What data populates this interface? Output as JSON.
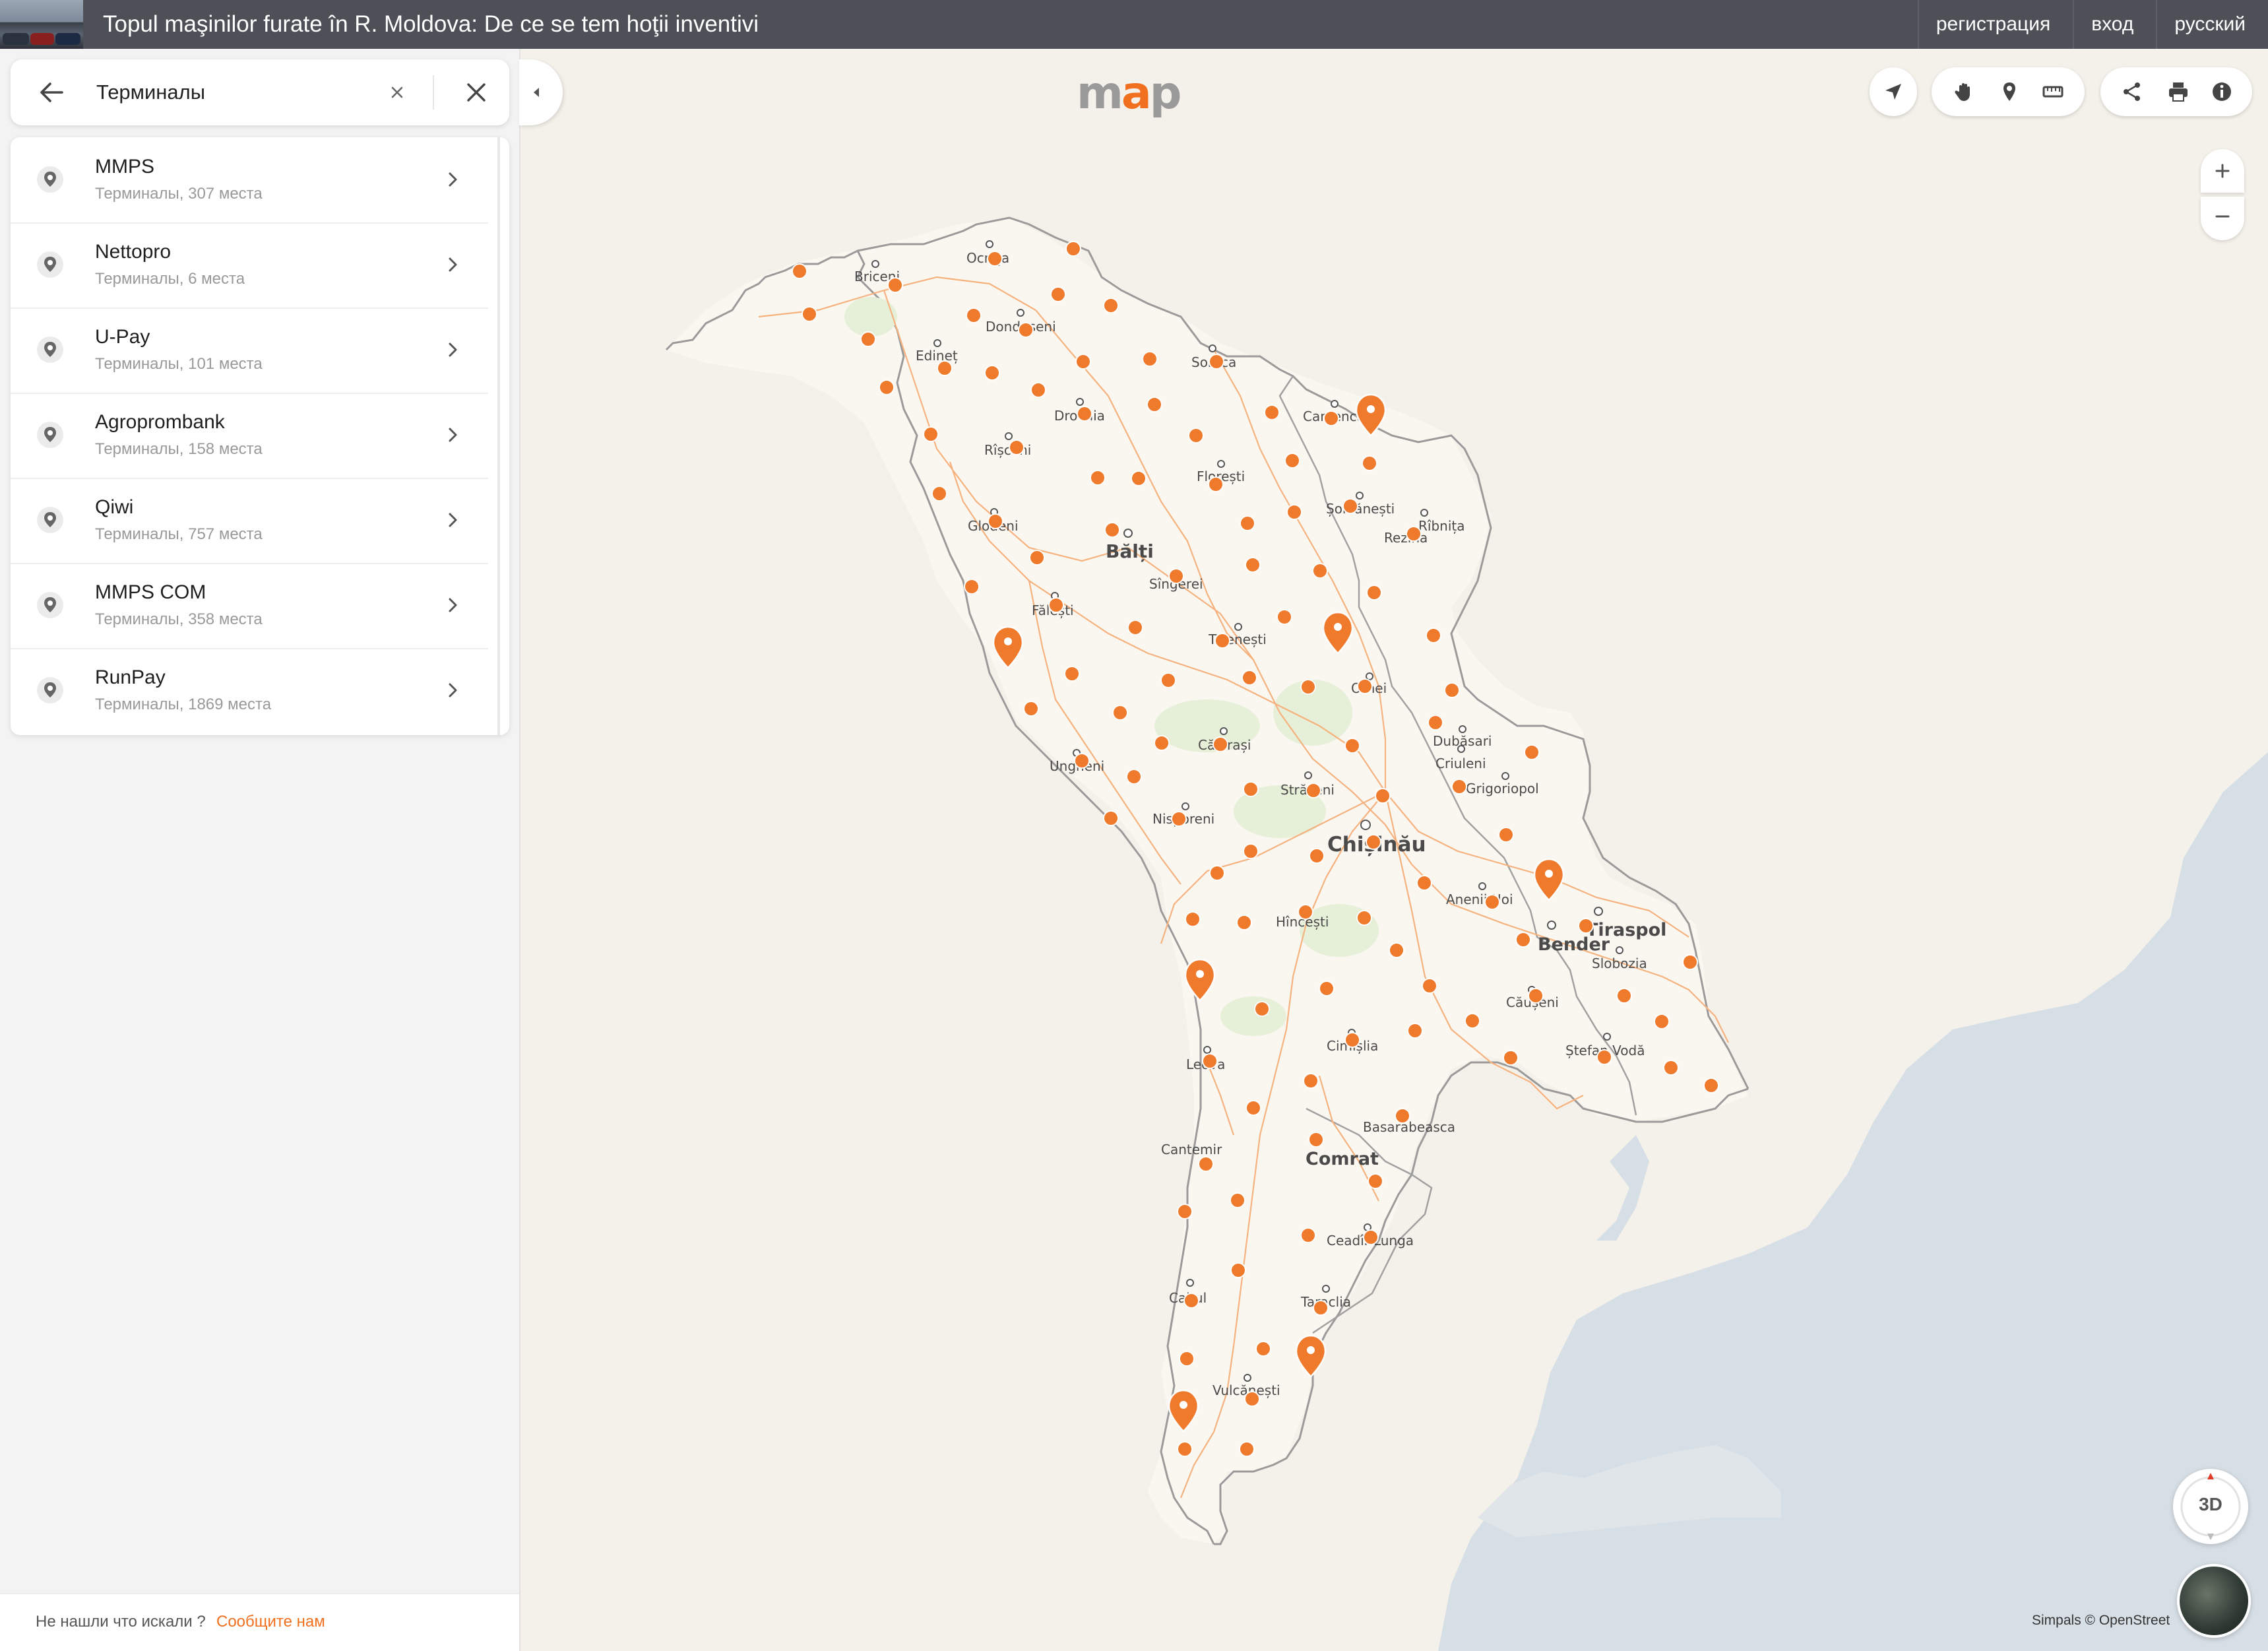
{
  "header": {
    "news_title": "Topul maşinilor furate în R. Moldova: De ce se tem hoţii inventivi",
    "links": [
      "регистрация",
      "вход",
      "русский"
    ]
  },
  "search": {
    "value": "Терминалы",
    "back_icon": "arrow-left-icon",
    "clear_icon": "small-x-icon",
    "close_icon": "close-icon"
  },
  "results": [
    {
      "title": "MMPS",
      "subtitle": "Терминалы, 307 места"
    },
    {
      "title": "Nettopro",
      "subtitle": "Терминалы, 6 места"
    },
    {
      "title": "U-Pay",
      "subtitle": "Терминалы, 101 места"
    },
    {
      "title": "Agroprombank",
      "subtitle": "Терминалы, 158 места"
    },
    {
      "title": "Qiwi",
      "subtitle": "Терминалы, 757 места"
    },
    {
      "title": "MMPS COM",
      "subtitle": "Терминалы, 358 места"
    },
    {
      "title": "RunPay",
      "subtitle": "Терминалы, 1869 места"
    }
  ],
  "feedback": {
    "text": "Не нашли что искали ?",
    "link": "Сообщите нам"
  },
  "map": {
    "logo": "map",
    "accent_color": "#f07020",
    "toolbar_icons": [
      "navigation-arrow-icon",
      "hand-icon",
      "pin-icon",
      "ruler-icon",
      "share-icon",
      "print-icon",
      "info-icon"
    ],
    "zoom_in": "+",
    "zoom_out": "−",
    "btn_3d": "3D",
    "attribution": "Simpals © OpenStreet",
    "cities": [
      {
        "name": "Briceni"
      },
      {
        "name": "Ocnița"
      },
      {
        "name": "Edineț"
      },
      {
        "name": "Dondușeni"
      },
      {
        "name": "Soroca"
      },
      {
        "name": "Camenca"
      },
      {
        "name": "Drochia"
      },
      {
        "name": "Rîșcani"
      },
      {
        "name": "Florești"
      },
      {
        "name": "Șoldănești"
      },
      {
        "name": "Rîbnița"
      },
      {
        "name": "Rezina"
      },
      {
        "name": "Glodeni"
      },
      {
        "name": "Bălți"
      },
      {
        "name": "Sîngerei"
      },
      {
        "name": "Fălești"
      },
      {
        "name": "Telenești"
      },
      {
        "name": "Orhei"
      },
      {
        "name": "Dubăsari"
      },
      {
        "name": "Criuleni"
      },
      {
        "name": "Grigoriopol"
      },
      {
        "name": "Ungheni"
      },
      {
        "name": "Călărași"
      },
      {
        "name": "Strășeni"
      },
      {
        "name": "Nisporeni"
      },
      {
        "name": "Chișinău"
      },
      {
        "name": "Anenii Noi"
      },
      {
        "name": "Tiraspol"
      },
      {
        "name": "Bender"
      },
      {
        "name": "Slobozia"
      },
      {
        "name": "Hîncești"
      },
      {
        "name": "Căușeni"
      },
      {
        "name": "Ștefan Vodă"
      },
      {
        "name": "Cimișlia"
      },
      {
        "name": "Leova"
      },
      {
        "name": "Basarabeasca"
      },
      {
        "name": "Cantemir"
      },
      {
        "name": "Comrat"
      },
      {
        "name": "Ceadîr-Lunga"
      },
      {
        "name": "Cahul"
      },
      {
        "name": "Taraclia"
      },
      {
        "name": "Vulcănești"
      }
    ]
  }
}
